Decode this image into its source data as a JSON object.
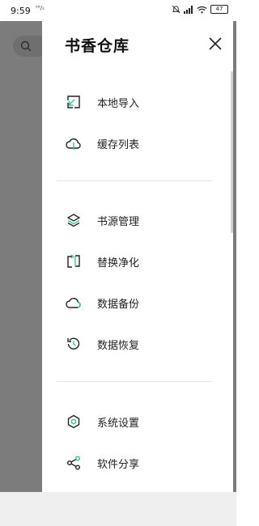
{
  "status": {
    "time": "9:59",
    "mini": "ᴷᴮ/ₛ",
    "battery": "47"
  },
  "drawer": {
    "title": "书香仓库",
    "groups": [
      [
        {
          "label": "本地导入",
          "icon": "import-icon"
        },
        {
          "label": "缓存列表",
          "icon": "cache-list-icon"
        }
      ],
      [
        {
          "label": "书源管理",
          "icon": "layers-icon"
        },
        {
          "label": "替换净化",
          "icon": "replace-icon"
        },
        {
          "label": "数据备份",
          "icon": "cloud-backup-icon"
        },
        {
          "label": "数据恢复",
          "icon": "restore-icon"
        }
      ],
      [
        {
          "label": "系统设置",
          "icon": "settings-icon"
        },
        {
          "label": "软件分享",
          "icon": "share-icon"
        }
      ]
    ]
  },
  "colors": {
    "accent": "#3fc1a0",
    "scrim": "#7c7c7c",
    "text": "#222222"
  }
}
